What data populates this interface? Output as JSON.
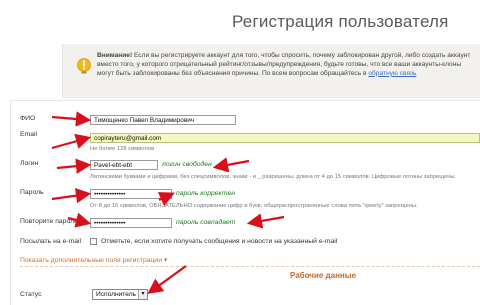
{
  "page": {
    "title": "Регистрация пользователя"
  },
  "notice": {
    "icon": "warning-bulb-icon",
    "bold": "Внимание!",
    "text": " Если вы регистрируете аккаунт для того, чтобы спросить, почему заблокирован другой, либо создать аккаунт вместо того, у которого отрицательный рейтинг/отзывы/предупреждения, будьте готовы, что все ваши аккаунты-клоны могут быть заблокированы без объяснения причины. По всем вопросам обращайтесь в ",
    "link": "обратную связь"
  },
  "form": {
    "fio": {
      "label": "ФИО",
      "value": "Тимощенко Павел Владимирович"
    },
    "email": {
      "label": "Email",
      "value": "copirayteru@gmail.com",
      "hint": "Не более 128 символов"
    },
    "login": {
      "label": "Логин",
      "value": "Pavel-ebt-ebt",
      "status": "логин свободен",
      "hint": "Латинскими буквами и цифрами, без спецсимволов, знаки - и _ разрешены, длина от 4 до 15 символов. Цифровые логины запрещены."
    },
    "password": {
      "label": "Пароль",
      "value": "••••••••••••••",
      "status": "пароль корректен",
      "hint": "От 8 до 15 символов, ОБЯЗАТЕЛЬНО содержание цифр и букв, общераспространенные слова типа \"qwerty\" запрещены."
    },
    "password_repeat": {
      "label": "Повторите пароль",
      "value": "••••••••••••••",
      "status": "пароль совпадает"
    },
    "email_notify": {
      "label": "Посылать на e-mail",
      "text": "Отметьте, если хотите получать сообщения и новости на указанный e-mail"
    },
    "more_link": "Показать дополнительные поля регистрации ▾",
    "work_section_title": "Рабочие данные",
    "status": {
      "label": "Статус",
      "value": "Исполнитель"
    }
  },
  "colors": {
    "arrow": "#d8101c",
    "ok_text": "#1c7a1c",
    "highlight": "#f5f8c0",
    "accent": "#c8692c"
  }
}
